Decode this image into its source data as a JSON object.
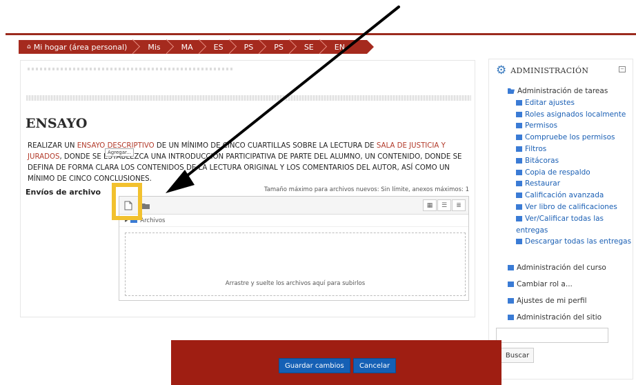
{
  "breadcrumb": {
    "items": [
      "Mi hogar (área personal)",
      "Mis",
      "MA",
      "ES",
      "PS",
      "PS",
      "SE",
      "EN"
    ]
  },
  "main": {
    "title": "ENSAYO",
    "description": {
      "p1": "REALIZAR UN ",
      "hl1": "ENSAYO DESCRIPTIVO",
      "p2": " DE UN MÍNIMO DE CINCO CUARTILLAS SOBRE LA LECTURA DE ",
      "hl2": "SALA DE JUSTICIA Y JURADOS",
      "p3": ", DONDE SE ESTABLEZCA UNA INTRODUCCIÓN PARTICIPATIVA DE PARTE DEL ALUMNO, UN CONTENIDO, DONDE SE DEFINA DE FORMA CLARA LOS CONTENIDOS DE LA LECTURA ORIGINAL Y LOS COMENTARIOS DEL AUTOR, ASÍ COMO UN MÍNIMO DE CINCO CONCLUSIONES."
    },
    "file_label": "Envíos de archivo",
    "max_size": "Tamaño máximo para archivos nuevos: Sin límite, anexos máximos: 1",
    "filepicker": {
      "tooltip": "Agregar...",
      "path": "Archivos",
      "drop_text": "Arrastre y suelte los archivos aquí para subirlos"
    }
  },
  "sidebar": {
    "title": "ADMINISTRACIÓN",
    "section": "Administración de tareas",
    "links": [
      "Editar ajustes",
      "Roles asignados localmente",
      "Permisos",
      "Compruebe los permisos",
      "Filtros",
      "Bitácoras",
      "Copia de respaldo",
      "Restaurar",
      "Calificación avanzada",
      "Ver libro de calificaciones",
      "Ver/Calificar todas las entregas",
      "Descargar todas las entregas"
    ],
    "top_items": [
      "Administración del curso",
      "Cambiar rol a...",
      "Ajustes de mi perfil",
      "Administración del sitio"
    ],
    "search_button": "Buscar"
  },
  "footer": {
    "save": "Guardar cambios",
    "cancel": "Cancelar"
  },
  "colors": {
    "brand_red": "#a52a1e",
    "footer_red": "#9f1e12",
    "highlight_yellow": "#f2c12e",
    "link_blue": "#1a5fb4",
    "button_blue": "#1560b5"
  }
}
